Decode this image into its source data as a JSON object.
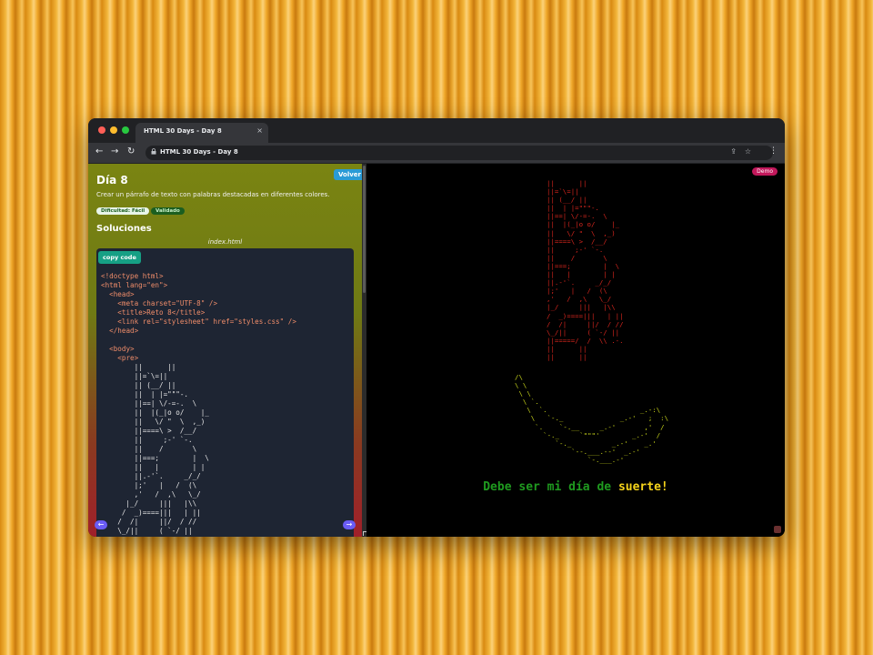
{
  "browser": {
    "tab_title": "HTML 30 Days - Day 8",
    "tab_close": "×",
    "url": "HTML 30 Days - Day 8",
    "back_icon": "←",
    "forward_icon": "→",
    "reload_icon": "↻",
    "lock_icon": "🔒",
    "share_icon": "⇪",
    "star_icon": "☆",
    "menu_icon": "⋮",
    "traffic_lights": [
      "#ff5f57",
      "#febc2e",
      "#28c840"
    ]
  },
  "left": {
    "volver_label": "Volver",
    "day_title": "Día 8",
    "description": "Crear un párrafo de texto con palabras destacadas en diferentes colores.",
    "badges": [
      {
        "label": "Dificultad: Fácil",
        "color": "#e8f5e9"
      },
      {
        "label": "Validado",
        "color": "#1b5e20"
      }
    ],
    "solutions_title": "Soluciones",
    "file_name": "index.html",
    "copy_label": "copy code",
    "prev_icon": "←",
    "next_icon": "→"
  },
  "code": {
    "doctype": "<!doctype html>",
    "html_open": "<html lang=\"en\">",
    "head_open": "<head>",
    "meta": "<meta charset=\"UTF-8\" />",
    "title_line": "<title>Reto 8</title>",
    "link": "<link rel=\"stylesheet\" href=\"styles.css\" />",
    "head_close": "</head>",
    "body_open": "<body>",
    "pre_open": "<pre>"
  },
  "code_art": "        ||      ||\n        ||=`\\=||\n        || (__/ ||\n        ||  | |=\"\"\"-.\n        ||==| \\/-=-.  \\\n        ||  |(_|o o/    |_\n        ||   \\/ \"  \\  ,_)\n        ||====\\ >  /__/\n        ||     ;-' `-.\n        ||    /       \\\n        ||===;        |  \\\n        ||   |        | |\n        ||.-'`.     _/_/\n        |;'   |   /  (\\\n        ,'   /  ,\\   \\_/\n      |_/     |||   |\\\\\n     /  _)====|||   | ||\n    /  /|     ||/  / //\n    \\_/||     ( `-/ ||\n        ||=====/  /  \\\\ .-.",
  "demo": {
    "badge": "Demo",
    "man_art": "||      ||\n||=`\\=||\n|| (__/ ||\n||  | |=\"\"\"-.\n||==| \\/-=-.  \\\n||  |(_|o o/    |_\n||   \\/ \"  \\  ,_)\n||====\\ >  /__/\n||     ;-' `-.\n||    /       \\\n||===;        |  \\\n||   |        | |\n||.-'`.     _/_/\n|;'   |   /  (\\\n,'   /  ,\\   \\_/\n|_/     |||   |\\\\\n/  _)====|||   | ||\n/  /|     ||/  / //\n\\_/||     ( `-/ ||\n||=====/  /  \\\\ .-.\n||      ||\n||      ||",
    "banana_art": "/\\\n\\ \\\n \\ \\\n  \\ `.\n   \\  `.                       _.-:\\\n    \\   `-._              _.-'   ;  :\\\n     `.    `-.__     _.-'       ,'  /\n       `-._     `\"\"\"'        _.-'  /\n          `-._          _.-'    _.'\n              `--.___.--'  _.-'\n                  `-.___.-'",
    "message_main": "Debe ser mi día de ",
    "message_highlight": "suerte!"
  }
}
